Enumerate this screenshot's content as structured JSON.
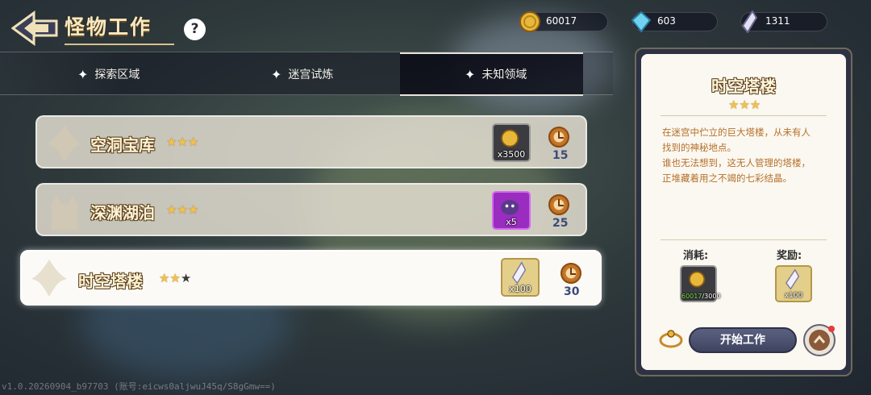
{
  "header": {
    "title": "怪物工作",
    "help": "?"
  },
  "currencies": [
    {
      "icon": "gold-coin-icon",
      "value": "60017"
    },
    {
      "icon": "blue-gem-icon",
      "value": "603"
    },
    {
      "icon": "crystal-icon",
      "value": "1311"
    }
  ],
  "tabs": [
    {
      "label": "探索区域",
      "active": false
    },
    {
      "label": "迷宫试炼",
      "active": false
    },
    {
      "label": "未知领域",
      "active": true
    }
  ],
  "jobs": [
    {
      "name": "空洞宝库",
      "stars": 3,
      "max_stars": 3,
      "reward_icon": "gold-coin-icon",
      "reward_qty": "x3500",
      "time": "15",
      "selected": false
    },
    {
      "name": "深渊湖泊",
      "stars": 3,
      "max_stars": 3,
      "reward_icon": "purple-monster-icon",
      "reward_qty": "x5",
      "time": "25",
      "selected": false
    },
    {
      "name": "时空塔楼",
      "stars": 2,
      "max_stars": 3,
      "reward_icon": "crystal-icon",
      "reward_qty": "x100",
      "time": "30",
      "selected": true
    }
  ],
  "detail": {
    "title": "时空塔楼",
    "stars": 3,
    "description": [
      "在迷宫中伫立的巨大塔楼，从未有人",
      "找到的神秘地点。",
      "谁也无法想到，这无人管理的塔楼，",
      "正堆藏着用之不竭的七彩结晶。"
    ],
    "cost_label": "消耗:",
    "reward_label": "奖励:",
    "cost_have": "60017",
    "cost_need": "/3000",
    "reward_qty": "x100",
    "start_button": "开始工作"
  },
  "version": "v1.0.20260904_b97703 (账号:eicws0aljwuJ45q/S8gGmw==)",
  "colors": {
    "accent_gold": "#f2c14e",
    "panel_bg": "#fbf8f1",
    "button": "#4a5070"
  }
}
